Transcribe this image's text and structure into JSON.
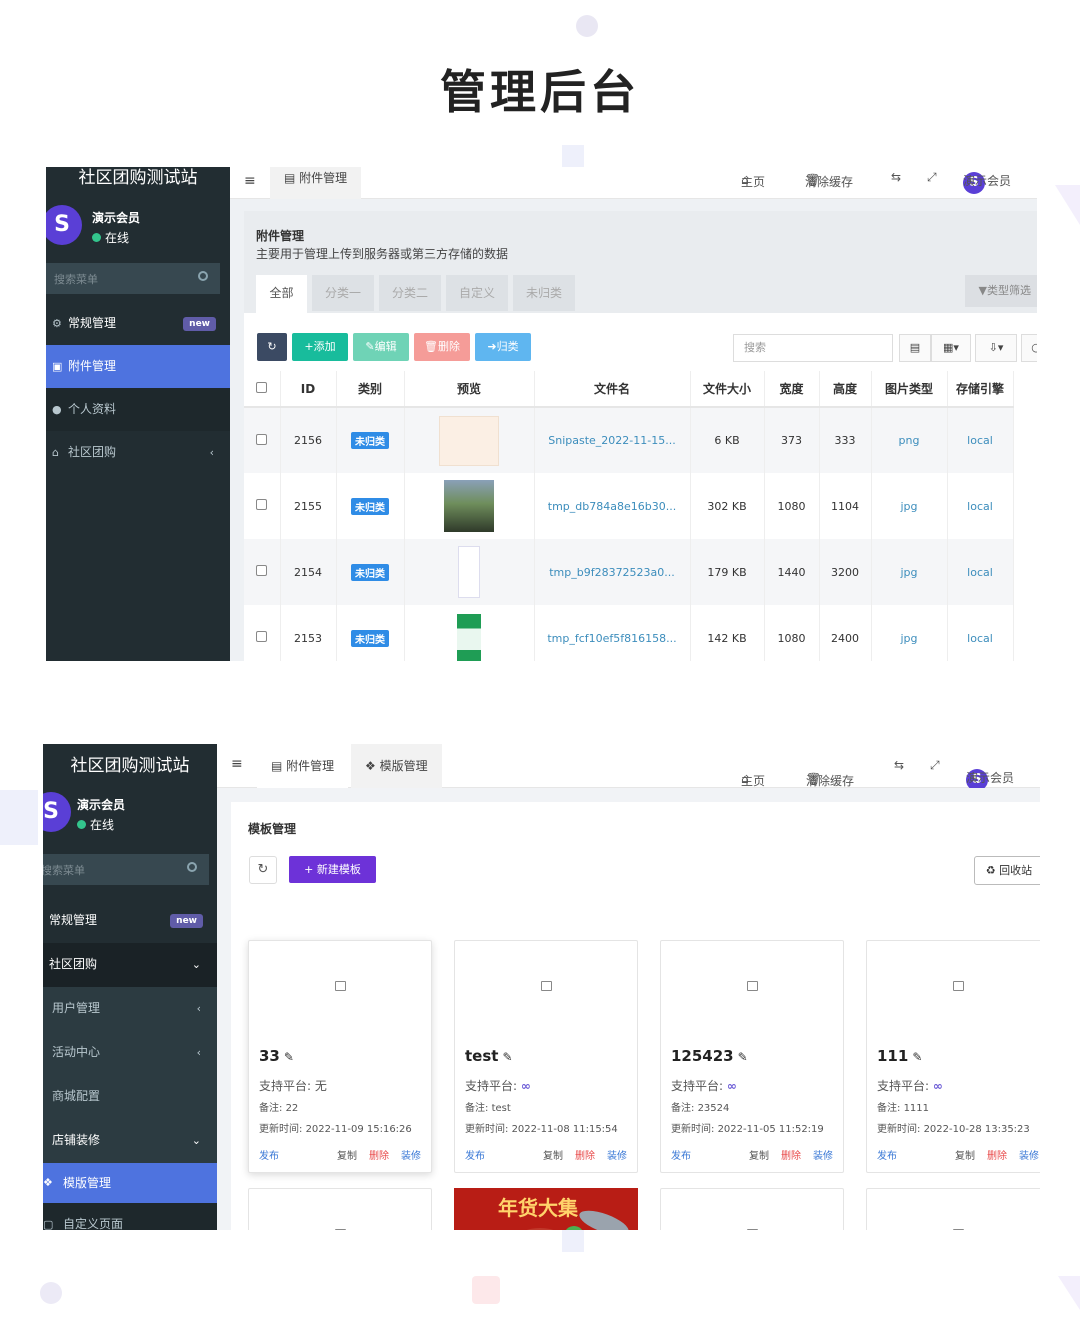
{
  "page_title": "管理后台",
  "shot1": {
    "sidebar": {
      "brand": "社区团购测试站",
      "user_name": "演示会员",
      "user_status": "在线",
      "search_placeholder": "搜索菜单",
      "items": [
        {
          "label": "常规管理",
          "badge": "new",
          "icon": "cogs-icon"
        },
        {
          "label": "附件管理",
          "icon": "file-image-icon"
        },
        {
          "label": "个人资料",
          "icon": "user-icon"
        },
        {
          "label": "社区团购",
          "icon": "home-icon",
          "arrow": "‹"
        }
      ]
    },
    "topbar": {
      "tab": "附件管理",
      "home": "主页",
      "clear_cache": "清除缓存",
      "user": "演示会员"
    },
    "header": {
      "title": "附件管理",
      "description": "主要用于管理上传到服务器或第三方存储的数据",
      "tabs": [
        "全部",
        "分类一",
        "分类二",
        "自定义",
        "未归类"
      ],
      "filter": "类型筛选"
    },
    "toolbar": {
      "add": "添加",
      "edit": "编辑",
      "delete": "删除",
      "classify": "归类",
      "search_placeholder": "搜索"
    },
    "table": {
      "columns": [
        "ID",
        "类别",
        "预览",
        "文件名",
        "文件大小",
        "宽度",
        "高度",
        "图片类型",
        "存储引擎"
      ],
      "rows": [
        {
          "id": "2156",
          "category": "未归类",
          "filename": "Snipaste_2022-11-15...",
          "size": "6 KB",
          "width": "373",
          "height": "333",
          "type": "png",
          "storage": "local"
        },
        {
          "id": "2155",
          "category": "未归类",
          "filename": "tmp_db784a8e16b30...",
          "size": "302 KB",
          "width": "1080",
          "height": "1104",
          "type": "jpg",
          "storage": "local"
        },
        {
          "id": "2154",
          "category": "未归类",
          "filename": "tmp_b9f28372523a0...",
          "size": "179 KB",
          "width": "1440",
          "height": "3200",
          "type": "jpg",
          "storage": "local"
        },
        {
          "id": "2153",
          "category": "未归类",
          "filename": "tmp_fcf10ef5f816158...",
          "size": "142 KB",
          "width": "1080",
          "height": "2400",
          "type": "jpg",
          "storage": "local"
        }
      ]
    }
  },
  "shot2": {
    "sidebar": {
      "brand": "社区团购测试站",
      "user_name": "演示会员",
      "user_status": "在线",
      "search_placeholder": "搜索菜单",
      "items": [
        {
          "label": "常规管理",
          "badge": "new"
        },
        {
          "label": "社区团购",
          "arrow": "⌄"
        },
        {
          "label": "用户管理",
          "arrow": "‹"
        },
        {
          "label": "活动中心",
          "arrow": "‹"
        },
        {
          "label": "商城配置"
        },
        {
          "label": "店铺装修",
          "arrow": "⌄"
        },
        {
          "label": "模版管理"
        },
        {
          "label": "自定义页面"
        }
      ]
    },
    "topbar": {
      "tab1": "附件管理",
      "tab2": "模版管理",
      "home": "主页",
      "clear_cache": "清除缓存",
      "user": "演示会员"
    },
    "panel": {
      "title": "模板管理",
      "new_button": "新建模板",
      "recycle_button": "回收站",
      "platform_label": "支持平台:",
      "note_label": "备注:",
      "time_label": "更新时间:",
      "actions": {
        "publish": "发布",
        "copy": "复制",
        "delete": "删除",
        "decorate": "装修"
      }
    },
    "cards": [
      {
        "name": "33",
        "platform": "无",
        "note": "22",
        "time": "2022-11-09 15:16:26"
      },
      {
        "name": "test",
        "platform": "",
        "note": "test",
        "time": "2022-11-08 11:15:54"
      },
      {
        "name": "125423",
        "platform": "",
        "note": "23524",
        "time": "2022-11-05 11:52:19"
      },
      {
        "name": "111",
        "platform": "",
        "note": "1111",
        "time": "2022-10-28 13:35:23"
      }
    ],
    "promo_text": "年货大集"
  },
  "colors": {
    "sidebar_bg": "#222d32",
    "active_blue": "#4e73df",
    "primary_purple": "#6d32d8",
    "badge_blue": "#2f8ce6"
  }
}
